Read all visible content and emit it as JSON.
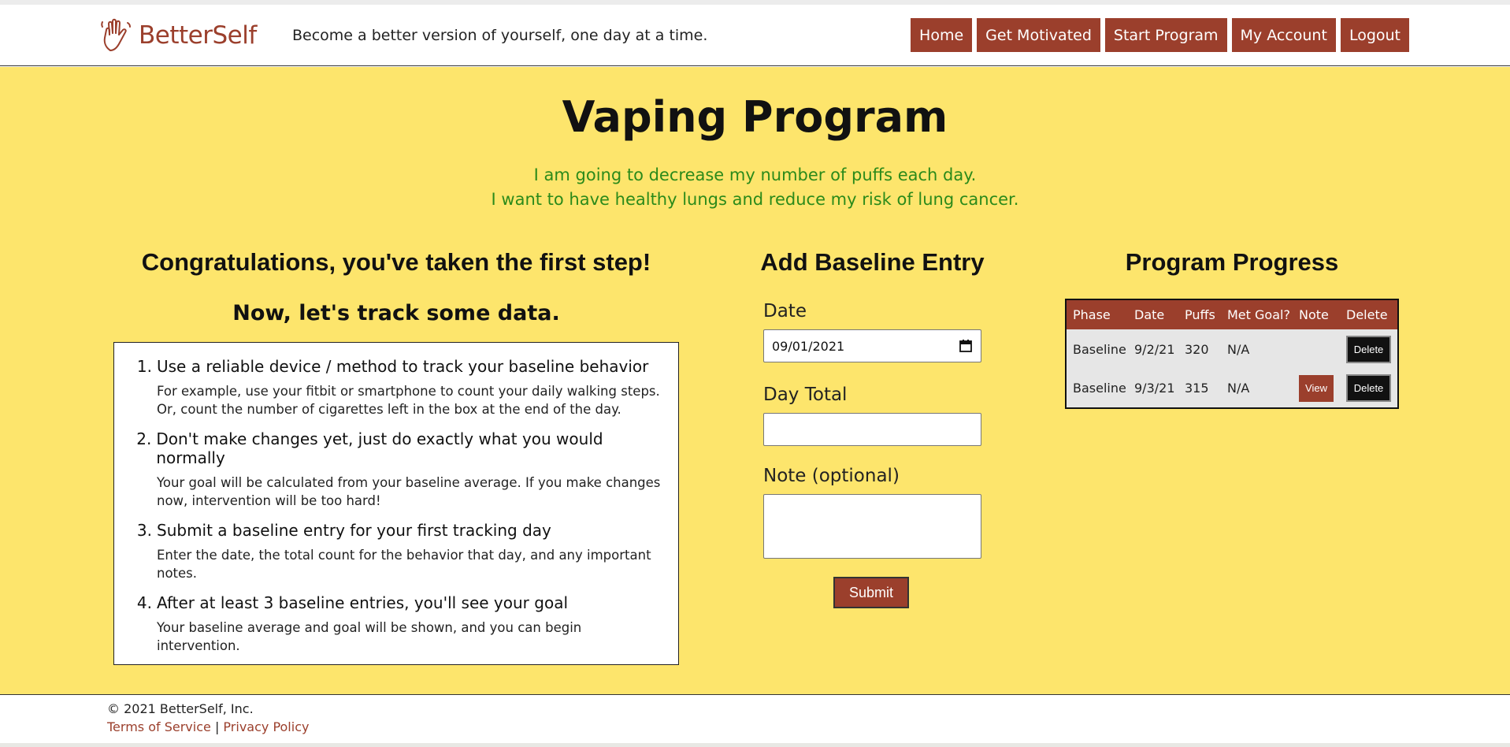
{
  "header": {
    "brand": "BetterSelf",
    "tagline": "Become a better version of yourself, one day at a time.",
    "nav": [
      "Home",
      "Get Motivated",
      "Start Program",
      "My Account",
      "Logout"
    ]
  },
  "program": {
    "title": "Vaping Program",
    "goal_statement": "I am going to decrease my number of puffs each day.",
    "motivation": "I want to have healthy lungs and reduce my risk of lung cancer."
  },
  "intro": {
    "heading": "Congratulations, you've taken the first step!",
    "subheading": "Now, let's track some data.",
    "steps": [
      {
        "num": "1.",
        "title": "Use a reliable device / method to track your baseline behavior",
        "desc": "For example, use your fitbit or smartphone to count your daily walking steps. Or, count the number of cigarettes left in the box at the end of the day."
      },
      {
        "num": "2.",
        "title": "Don't make changes yet, just do exactly what you would normally",
        "desc": "Your goal will be calculated from your baseline average. If you make changes now, intervention will be too hard!"
      },
      {
        "num": "3.",
        "title": "Submit a baseline entry for your first tracking day",
        "desc": "Enter the date, the total count for the behavior that day, and any important notes."
      },
      {
        "num": "4.",
        "title": "After at least 3 baseline entries, you'll see your goal",
        "desc": "Your baseline average and goal will be shown, and you can begin intervention."
      }
    ]
  },
  "form": {
    "heading": "Add Baseline Entry",
    "date_label": "Date",
    "date_value": "09/01/2021",
    "total_label": "Day Total",
    "note_label": "Note (optional)",
    "submit_label": "Submit"
  },
  "progress": {
    "heading": "Program Progress",
    "columns": [
      "Phase",
      "Date",
      "Puffs",
      "Met Goal?",
      "Note",
      "Delete"
    ],
    "rows": [
      {
        "phase": "Baseline",
        "date": "9/2/21",
        "puffs": "320",
        "met_goal": "N/A",
        "note": "",
        "delete": "Delete"
      },
      {
        "phase": "Baseline",
        "date": "9/3/21",
        "puffs": "315",
        "met_goal": "N/A",
        "note": "View",
        "delete": "Delete"
      }
    ]
  },
  "footer": {
    "copyright": "© 2021 BetterSelf, Inc.",
    "terms": "Terms of Service",
    "separator": "|",
    "privacy": "Privacy Policy"
  },
  "colors": {
    "brand": "#9b3f2c",
    "background": "#fde56c",
    "motivation_text": "#2b8a1a"
  }
}
